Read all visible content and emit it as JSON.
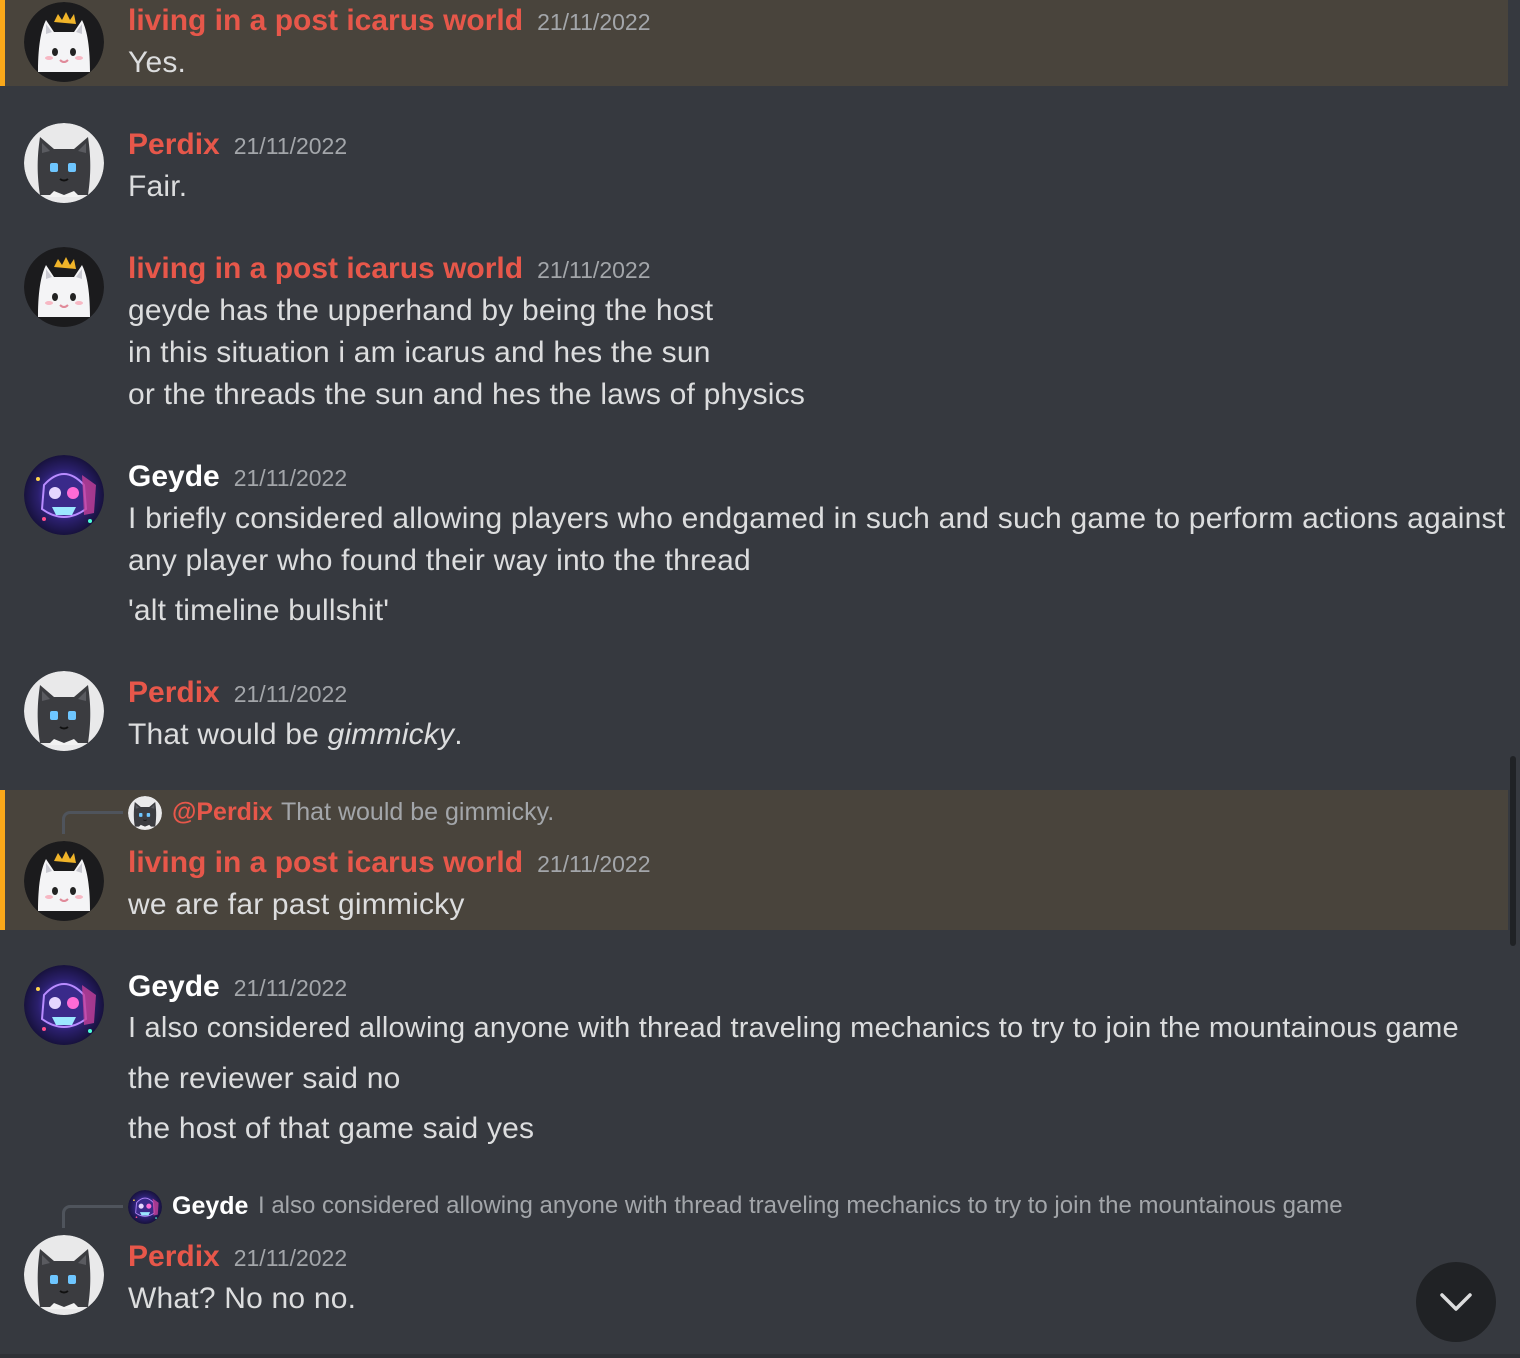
{
  "colors": {
    "background": "#36393f",
    "mention_highlight": "#49443c",
    "mention_border": "#faa81a",
    "user_red": "#e7574a",
    "user_white": "#ffffff",
    "text": "#dcddde",
    "muted": "#a3a6aa"
  },
  "messages": [
    {
      "author": "living in a post icarus world",
      "timestamp": "21/11/2022",
      "lines": [
        "Yes."
      ],
      "avatar": "white-cat-crown-avatar"
    },
    {
      "author": "Perdix",
      "timestamp": "21/11/2022",
      "lines": [
        "Fair."
      ],
      "avatar": "black-cat-avatar"
    },
    {
      "author": "living in a post icarus world",
      "timestamp": "21/11/2022",
      "lines": [
        "geyde has the upperhand by being the host",
        "in this situation i am icarus and hes the sun",
        "or the threads the sun and hes the laws of physics"
      ],
      "avatar": "white-cat-crown-avatar"
    },
    {
      "author": "Geyde",
      "timestamp": "21/11/2022",
      "lines": [
        "I briefly considered allowing players who endgamed in such and such game to perform actions against",
        "any player who found their way into the thread",
        "'alt timeline bullshit'"
      ],
      "avatar": "cosmic-skull-avatar"
    },
    {
      "author": "Perdix",
      "timestamp": "21/11/2022",
      "line_prefix": "That would be ",
      "line_italic": "gimmicky",
      "line_suffix": ".",
      "avatar": "black-cat-avatar"
    },
    {
      "reply_user": "@Perdix",
      "reply_text": "That would be gimmicky.",
      "author": "living in a post icarus world",
      "timestamp": "21/11/2022",
      "lines": [
        "we are far past gimmicky"
      ],
      "avatar": "white-cat-crown-avatar"
    },
    {
      "author": "Geyde",
      "timestamp": "21/11/2022",
      "lines": [
        "I also considered allowing anyone with thread traveling mechanics to try to join the mountainous game",
        "the reviewer said no",
        "the host of that game said yes"
      ],
      "avatar": "cosmic-skull-avatar"
    },
    {
      "reply_user": "Geyde",
      "reply_text": "I also considered allowing anyone with thread traveling mechanics to try to join the mountainous game",
      "author": "Perdix",
      "timestamp": "21/11/2022",
      "lines": [
        "What? No no no."
      ],
      "avatar": "black-cat-avatar"
    }
  ],
  "jump_button": {
    "icon": "chevron-down-icon"
  }
}
